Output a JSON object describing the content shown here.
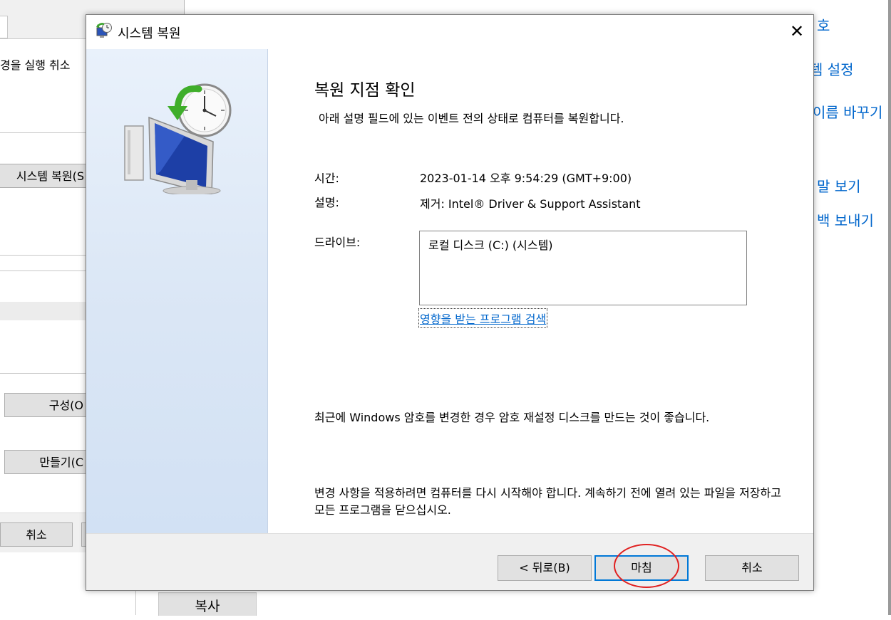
{
  "background": {
    "left_window": {
      "text_fragment": "경을 실행 취소",
      "restore_button": "시스템 복원(S",
      "configure_button": "구성(O",
      "create_button": "만들기(C",
      "cancel_button": "취소"
    },
    "right_links": [
      "호",
      "템 설정",
      "이름 바꾸기",
      "말 보기",
      "백 보내기"
    ],
    "bottom_button": "복사"
  },
  "dialog": {
    "title": "시스템 복원",
    "close_glyph": "✕",
    "heading": "복원 지점 확인",
    "subtitle": "아래 설명 필드에 있는 이벤트 전의 상태로 컴퓨터를 복원합니다.",
    "time_label": "시간:",
    "time_value": "2023-01-14 오후 9:54:29 (GMT+9:00)",
    "description_label": "설명:",
    "description_value": "제거: Intel® Driver & Support Assistant",
    "drive_label": "드라이브:",
    "drives": [
      "로컬 디스크 (C:) (시스템)"
    ],
    "affected_programs_link": "영향을 받는 프로그램 검색",
    "password_note": "최근에 Windows 암호를 변경한 경우 암호 재설정 디스크를 만드는 것이 좋습니다.",
    "restart_note": "변경 사항을 적용하려면 컴퓨터를 다시 시작해야 합니다. 계속하기 전에 열려 있는 파일을 저장하고 모든 프로그램을 닫으십시오.",
    "buttons": {
      "back": "< 뒤로(B)",
      "finish": "마침",
      "cancel": "취소"
    }
  },
  "colors": {
    "link": "#0066cc",
    "default_button_border": "#0078d7",
    "highlight_circle": "#e02020"
  },
  "icons": [
    "system-restore-icon",
    "close-icon",
    "restore-monitor-clock-icon"
  ]
}
